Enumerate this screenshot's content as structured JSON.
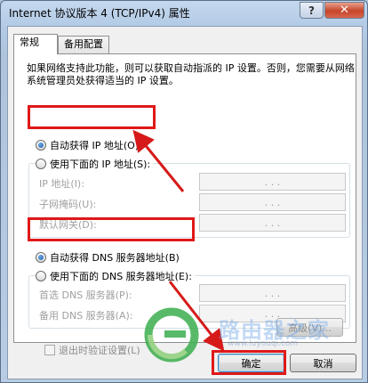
{
  "window": {
    "title": "Internet 协议版本 4 (TCP/IPv4) 属性",
    "help_label": "?",
    "close_label": "✕"
  },
  "tabs": [
    {
      "label": "常规"
    },
    {
      "label": "备用配置"
    }
  ],
  "description": "如果网络支持此功能，则可以获取自动指派的 IP 设置。否则，您需要从网络系统管理员处获得适当的 IP 设置。",
  "ip_section": {
    "auto_label": "自动获得 IP 地址(O)",
    "manual_label": "使用下面的 IP 地址(S):",
    "fields": [
      {
        "label": "IP 地址(I):",
        "value": ". . ."
      },
      {
        "label": "子网掩码(U):",
        "value": ". . ."
      },
      {
        "label": "默认网关(D):",
        "value": ". . ."
      }
    ]
  },
  "dns_section": {
    "auto_label": "自动获得 DNS 服务器地址(B)",
    "manual_label": "使用下面的 DNS 服务器地址(E):",
    "fields": [
      {
        "label": "首选 DNS 服务器(P):",
        "value": ". . ."
      },
      {
        "label": "备用 DNS 服务器(A):",
        "value": ". . ."
      }
    ]
  },
  "validate_label": "退出时验证设置(L)",
  "advanced_label": "高级(V)...",
  "ok_label": "确定",
  "cancel_label": "取消",
  "watermark": {
    "text": "路由器之家",
    "url": "www.luyouqi.com"
  },
  "colors": {
    "highlight": "#e01818",
    "arrow": "#d61a1a",
    "watermark_green": "#3cae4e"
  }
}
